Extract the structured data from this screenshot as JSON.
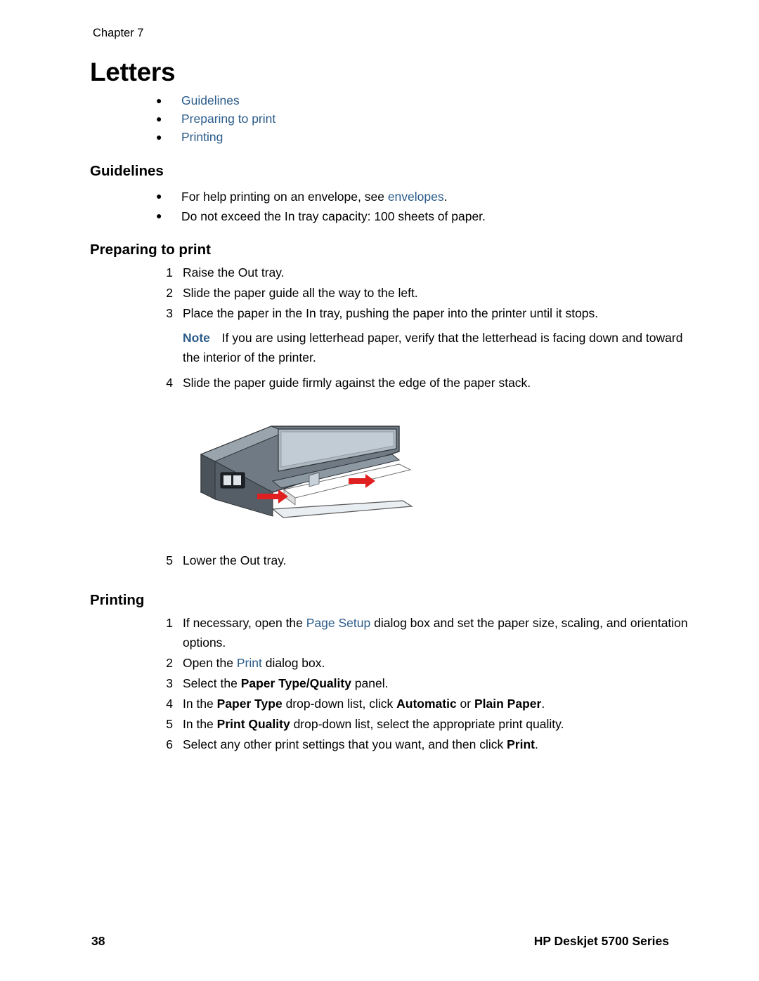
{
  "header": {
    "chapter": "Chapter 7"
  },
  "title": "Letters",
  "toc": [
    {
      "label": "Guidelines"
    },
    {
      "label": "Preparing to print"
    },
    {
      "label": "Printing"
    }
  ],
  "guidelines": {
    "heading": "Guidelines",
    "items": [
      {
        "pre": "For help printing on an envelope, see ",
        "link": "envelopes",
        "post": "."
      },
      {
        "pre": "Do not exceed the In tray capacity: 100 sheets of paper.",
        "link": "",
        "post": ""
      }
    ]
  },
  "preparing": {
    "heading": "Preparing to print",
    "steps": [
      {
        "num": "1",
        "text": "Raise the Out tray."
      },
      {
        "num": "2",
        "text": "Slide the paper guide all the way to the left."
      },
      {
        "num": "3",
        "text": "Place the paper in the In tray, pushing the paper into the printer until it stops."
      }
    ],
    "note": {
      "label": "Note",
      "text": "If you are using letterhead paper, verify that the letterhead is facing down and toward the interior of the printer."
    },
    "step4": {
      "num": "4",
      "text": "Slide the paper guide firmly against the edge of the paper stack."
    },
    "step5": {
      "num": "5",
      "text": "Lower the Out tray."
    }
  },
  "figure": {
    "name": "printer-loading-paper-illustration"
  },
  "printing": {
    "heading": "Printing",
    "steps": [
      {
        "num": "1",
        "part1": "If necessary, open the ",
        "link": "Page Setup",
        "part2": " dialog box and set the paper size, scaling, and orientation options."
      },
      {
        "num": "2",
        "part1": "Open the ",
        "link": "Print",
        "part2": " dialog box."
      }
    ],
    "step3": {
      "num": "3",
      "pre": "Select the ",
      "bold": "Paper Type/Quality",
      "post": " panel."
    },
    "step4": {
      "num": "4",
      "pre": "In the ",
      "bold1": "Paper Type",
      "mid1": " drop-down list, click ",
      "bold2": "Automatic",
      "mid2": " or ",
      "bold3": "Plain Paper",
      "post": "."
    },
    "step5": {
      "num": "5",
      "pre": "In the ",
      "bold": "Print Quality",
      "post": " drop-down list, select the appropriate print quality."
    },
    "step6": {
      "num": "6",
      "pre": "Select any other print settings that you want, and then click ",
      "bold": "Print",
      "post": "."
    }
  },
  "footer": {
    "page_number": "38",
    "product": "HP Deskjet 5700 Series"
  }
}
